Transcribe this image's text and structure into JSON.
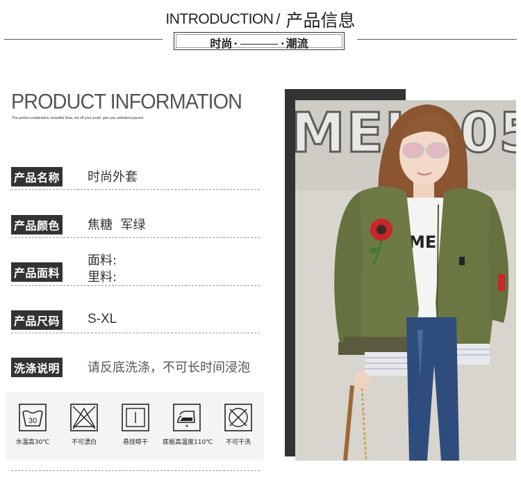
{
  "header": {
    "title_en": "INTRODUCTION",
    "slash": "/",
    "title_cn": "产品信息",
    "tag_left": "时尚",
    "tag_right": "潮流",
    "dot": "·"
  },
  "info": {
    "title": "PRODUCT INFORMATION",
    "subtitle": "The perfect combination, beautiful lines, set off your youth, give you unlimited passion",
    "rows": [
      {
        "label": "产品名称",
        "value": "时尚外套"
      },
      {
        "label": "产品颜色",
        "value": "焦糖  军绿"
      },
      {
        "label": "产品面料",
        "value_lines": [
          "面料:",
          "里料:"
        ]
      },
      {
        "label": "产品尺码",
        "value": "S-XL"
      },
      {
        "label": "洗涤说明",
        "value": "请反底洗涤，不可长时间浸泡"
      }
    ]
  },
  "wash_icons": [
    {
      "icon": "wash-30-icon",
      "caption": "水温高30℃",
      "number": "30"
    },
    {
      "icon": "no-bleach-icon",
      "caption": "不可漂白"
    },
    {
      "icon": "hang-dry-icon",
      "caption": "悬挂晾干"
    },
    {
      "icon": "iron-icon",
      "caption": "底板高温度110℃"
    },
    {
      "icon": "no-dry-clean-icon",
      "caption": "不可干洗"
    }
  ],
  "photo": {
    "wall_text": "MEL205",
    "shirt_text": "ME"
  },
  "colors": {
    "jacket": "#6e7a45",
    "label_bg": "#333333",
    "frame": "#333333",
    "wash_bg": "#f4f4f4"
  }
}
